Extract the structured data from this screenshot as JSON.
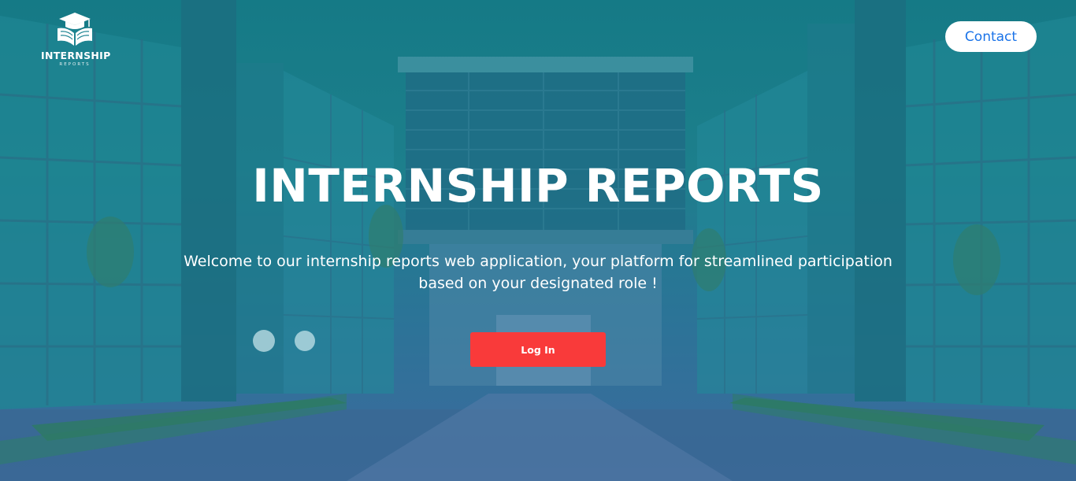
{
  "logo": {
    "name": "INTERNSHIP",
    "tagline": "REPORTS",
    "icon": "graduation-cap-book-icon"
  },
  "nav": {
    "contact_label": "Contact"
  },
  "hero": {
    "title": "INTERNSHIP REPORTS",
    "subtitle": "Welcome to our internship reports web application, your platform for streamlined participation based on your designated role !",
    "login_label": "Log In",
    "background": "campus-building-photo"
  },
  "colors": {
    "overlay_top": "#157a86",
    "overlay_bottom": "#3d6a9e",
    "login_button": "#f93a3a",
    "contact_text": "#1a73e8"
  }
}
